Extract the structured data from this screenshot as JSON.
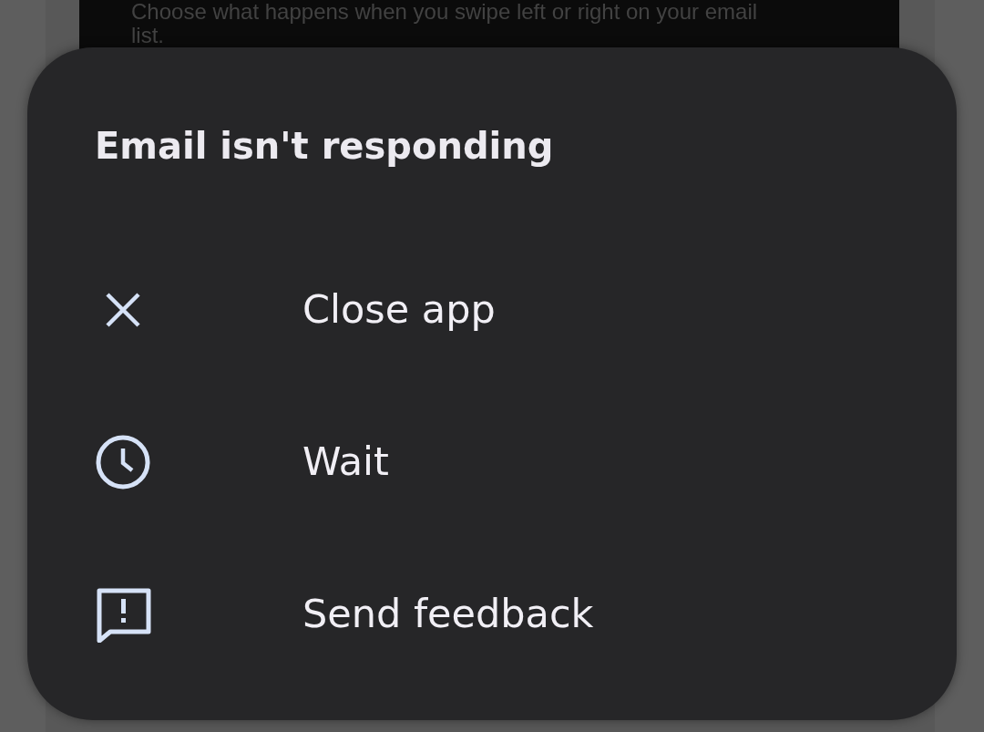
{
  "background": {
    "description": "Choose what happens when you swipe left or right on your email list."
  },
  "dialog": {
    "title": "Email isn't responding",
    "options": [
      {
        "kind": "close",
        "label": "Close app"
      },
      {
        "kind": "wait",
        "label": "Wait"
      },
      {
        "kind": "feedback",
        "label": "Send feedback"
      }
    ]
  }
}
